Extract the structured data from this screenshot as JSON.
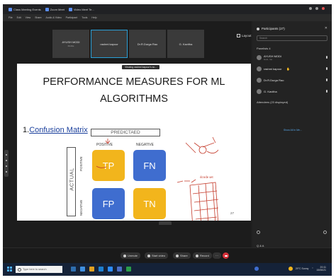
{
  "browser": {
    "tabs": [
      "Class Meeting Events",
      "Zoom Meet",
      "Video Meet Te..."
    ],
    "menu": [
      "File",
      "Edit",
      "View",
      "Share",
      "Audio & Video",
      "Participant",
      "Tools",
      "Help"
    ]
  },
  "meeting": {
    "thumbnails": [
      {
        "name": "AYUSH MODI",
        "sub": "Mobile"
      },
      {
        "name": "rashmi kapoor",
        "sub": ""
      },
      {
        "name": "Dr.R.Durga Rao",
        "sub": ""
      },
      {
        "name": "G. Kavitha",
        "sub": ""
      }
    ],
    "layout_label": "Layout",
    "viewing_text": "Viewing rashmi kapoor's sc...",
    "slide": {
      "title_line1": "PERFORMANCE MEASURES FOR ML",
      "title_line2": "ALGORITHMS",
      "section_number": "1.",
      "section_title": "Confusion Matrix",
      "predicted_label": "PREDICTAED",
      "positive_label": "POSITIVE",
      "negative_label": "NEGATIVE",
      "actual_label": "ACTUAL",
      "row_positive": "POSITIVE",
      "row_negative": "NEGATIVE",
      "tp": "TP",
      "fn": "FN",
      "fp": "FP",
      "tn": "TN",
      "handwritten_note": "dcode set",
      "page_number": "27"
    },
    "colors": {
      "tp_tn": "#f2b51c",
      "fn_fp": "#3f6dcf",
      "annotation": "#c43a2a"
    }
  },
  "controls": {
    "audio": "Unmute",
    "video": "Start video",
    "share": "Share",
    "record": "Record"
  },
  "participants_panel": {
    "title": "Participants (27)",
    "search_placeholder": "Search",
    "panelists_heading": "Panelists 4",
    "panelists": [
      {
        "name": "AYUSH MODI",
        "sub": "Host, me"
      },
      {
        "name": "rashmi kapoor",
        "sub": ""
      },
      {
        "name": "Dr.R.Durga Rao",
        "sub": ""
      },
      {
        "name": "G. Kavitha",
        "sub": ""
      }
    ],
    "attendees_heading": "Attendees (23 displayed)",
    "show_all": "Show All in Me...",
    "qa_label": "Q & A",
    "tab_participants": "Participants",
    "tab_chat": "Chat"
  },
  "taskbar": {
    "search_placeholder": "Type here to search",
    "weather": "29°C Sunny",
    "time": "20:11",
    "date": "15/06/21"
  }
}
